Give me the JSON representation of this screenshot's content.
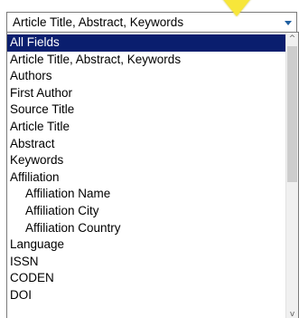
{
  "select": {
    "value": "Article Title, Abstract, Keywords",
    "arrow_icon": "triangle-down-icon"
  },
  "options": [
    {
      "label": "All Fields",
      "selected": true,
      "indent": false
    },
    {
      "label": "Article Title, Abstract, Keywords",
      "selected": false,
      "indent": false
    },
    {
      "label": "Authors",
      "selected": false,
      "indent": false
    },
    {
      "label": "First Author",
      "selected": false,
      "indent": false
    },
    {
      "label": "Source Title",
      "selected": false,
      "indent": false
    },
    {
      "label": "Article Title",
      "selected": false,
      "indent": false
    },
    {
      "label": "Abstract",
      "selected": false,
      "indent": false
    },
    {
      "label": "Keywords",
      "selected": false,
      "indent": false
    },
    {
      "label": "Affiliation",
      "selected": false,
      "indent": false
    },
    {
      "label": "Affiliation Name",
      "selected": false,
      "indent": true
    },
    {
      "label": "Affiliation City",
      "selected": false,
      "indent": true
    },
    {
      "label": "Affiliation Country",
      "selected": false,
      "indent": true
    },
    {
      "label": "Language",
      "selected": false,
      "indent": false
    },
    {
      "label": "ISSN",
      "selected": false,
      "indent": false
    },
    {
      "label": "CODEN",
      "selected": false,
      "indent": false
    },
    {
      "label": "DOI",
      "selected": false,
      "indent": false
    }
  ],
  "scrollbar": {
    "up_glyph": "^",
    "down_glyph": "v"
  },
  "colors": {
    "selected_bg": "#0a1e6e",
    "arrow": "#1f5fa0",
    "highlight_pointer": "#f7e63a"
  }
}
